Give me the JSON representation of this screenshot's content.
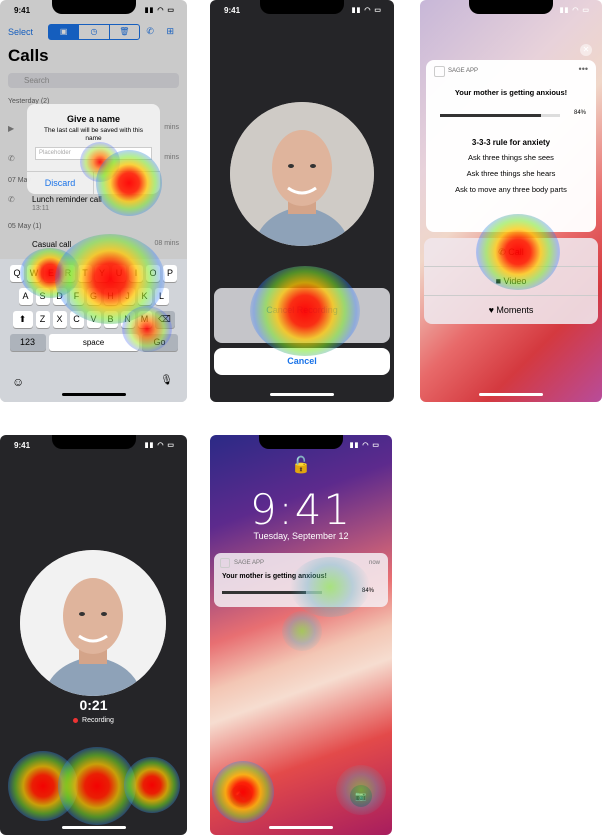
{
  "status": {
    "time": "9:41"
  },
  "calls_screen": {
    "nav": {
      "select": "Select",
      "seg": [
        "▣",
        "◷",
        "🗑"
      ],
      "icons": "✆ ⊞"
    },
    "title": "Calls",
    "search_placeholder": "Search",
    "sections": [
      {
        "label": "Yesterday  (2)"
      },
      {
        "label": "07 May"
      },
      {
        "label": "05 May  (1)"
      }
    ],
    "rows": [
      {
        "name": "",
        "duration": "mins"
      },
      {
        "name": "",
        "duration": "mins"
      },
      {
        "name": "Lunch reminder call",
        "time": "13:11",
        "duration": ""
      },
      {
        "name": "Casual call",
        "duration": "08 mins"
      }
    ],
    "alert": {
      "title": "Give a name",
      "message": "The last call will be saved with this name",
      "placeholder": "Placeholder",
      "discard": "Discard",
      "save": ""
    },
    "keyboard": {
      "row1": [
        "Q",
        "W",
        "E",
        "R",
        "T",
        "Y",
        "U",
        "I",
        "O",
        "P"
      ],
      "row2": [
        "A",
        "S",
        "D",
        "F",
        "G",
        "H",
        "J",
        "K",
        "L"
      ],
      "row3": [
        "Z",
        "X",
        "C",
        "V",
        "B",
        "N",
        "M"
      ],
      "shift": "⬆",
      "delete": "⌫",
      "num": "123",
      "space": "space",
      "go": "Go",
      "emoji": "☺",
      "mic": "🎙"
    }
  },
  "save_sheet_screen": {
    "option": "Cancel Recording",
    "cancel": "Cancel"
  },
  "notification_expanded": {
    "app": "SAGE APP",
    "more": "•••",
    "message": "Your mother is getting anxious!",
    "progress": 0.84,
    "progress_label": "84%",
    "rule_title": "3-3-3 rule for anxiety",
    "rule_lines": [
      "Ask three things she sees",
      "Ask three things she hears",
      "Ask to move any three body parts"
    ],
    "actions": [
      "Call",
      "Video",
      "Moments"
    ],
    "action_icons": [
      "phone-icon",
      "video-icon",
      "heart-icon"
    ],
    "close": "✕"
  },
  "recording_screen": {
    "timer": "0:21",
    "status": "Recording"
  },
  "lock_screen": {
    "lock": "🔓",
    "time": "9:41",
    "date": "Tuesday, September 12",
    "notification": {
      "app": "SAGE APP",
      "when": "now",
      "message": "Your mother is getting anxious!",
      "progress": 0.84,
      "progress_label": "84%"
    },
    "flashlight": "🔦",
    "camera": "📷"
  }
}
